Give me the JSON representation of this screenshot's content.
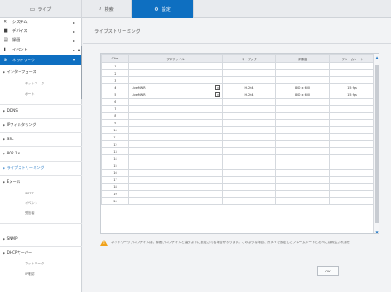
{
  "tabs": [
    {
      "label": "ライブ",
      "icon": "monitor-icon"
    },
    {
      "label": "検索",
      "icon": "search-icon"
    },
    {
      "label": "設定",
      "icon": "gear-icon"
    }
  ],
  "sidebar": {
    "top_items": [
      {
        "label": "システム",
        "icon": "tools-icon"
      },
      {
        "label": "デバイス",
        "icon": "camera-icon"
      },
      {
        "label": "録画",
        "icon": "record-icon"
      },
      {
        "label": "イベント",
        "icon": "event-icon"
      },
      {
        "label": "ネットワーク",
        "icon": "network-icon"
      }
    ],
    "sections": [
      {
        "label": "インターフェース",
        "subs": [
          "ネットワーク",
          "ポート"
        ]
      },
      {
        "label": "DDNS",
        "subs": []
      },
      {
        "label": "IPフィルタリング",
        "subs": []
      },
      {
        "label": "SSL",
        "subs": []
      },
      {
        "label": "802.1x",
        "subs": []
      },
      {
        "label": "ライブストリーミング",
        "subs": []
      },
      {
        "label": "Eメール",
        "subs": [
          "SMTP",
          "イベント",
          "受信者"
        ]
      },
      {
        "label": "SNMP",
        "subs": []
      },
      {
        "label": "DHCPサーバー",
        "subs": [
          "ネットワーク",
          "IP確認"
        ]
      }
    ]
  },
  "page": {
    "title": "ライブストリーミング"
  },
  "table": {
    "headers": [
      "CH↔",
      "プロファイル",
      "コーデック",
      "解像度",
      "フレームレート"
    ],
    "rows": [
      {
        "ch": "1",
        "profile": "",
        "codec": "",
        "res": "",
        "fps": ""
      },
      {
        "ch": "2",
        "profile": "",
        "codec": "",
        "res": "",
        "fps": ""
      },
      {
        "ch": "3",
        "profile": "",
        "codec": "",
        "res": "",
        "fps": ""
      },
      {
        "ch": "4",
        "profile": "LiveMWR",
        "codec": "H.264",
        "res": "800 x 600",
        "fps": "15 fps"
      },
      {
        "ch": "5",
        "profile": "LiveMWR",
        "codec": "H.264",
        "res": "800 x 600",
        "fps": "15 fps"
      },
      {
        "ch": "6",
        "profile": "",
        "codec": "",
        "res": "",
        "fps": ""
      },
      {
        "ch": "7",
        "profile": "",
        "codec": "",
        "res": "",
        "fps": ""
      },
      {
        "ch": "8",
        "profile": "",
        "codec": "",
        "res": "",
        "fps": ""
      },
      {
        "ch": "9",
        "profile": "",
        "codec": "",
        "res": "",
        "fps": ""
      },
      {
        "ch": "10",
        "profile": "",
        "codec": "",
        "res": "",
        "fps": ""
      },
      {
        "ch": "11",
        "profile": "",
        "codec": "",
        "res": "",
        "fps": ""
      },
      {
        "ch": "12",
        "profile": "",
        "codec": "",
        "res": "",
        "fps": ""
      },
      {
        "ch": "13",
        "profile": "",
        "codec": "",
        "res": "",
        "fps": ""
      },
      {
        "ch": "14",
        "profile": "",
        "codec": "",
        "res": "",
        "fps": ""
      },
      {
        "ch": "15",
        "profile": "",
        "codec": "",
        "res": "",
        "fps": ""
      },
      {
        "ch": "16",
        "profile": "",
        "codec": "",
        "res": "",
        "fps": ""
      },
      {
        "ch": "17",
        "profile": "",
        "codec": "",
        "res": "",
        "fps": ""
      },
      {
        "ch": "18",
        "profile": "",
        "codec": "",
        "res": "",
        "fps": ""
      },
      {
        "ch": "19",
        "profile": "",
        "codec": "",
        "res": "",
        "fps": ""
      },
      {
        "ch": "20",
        "profile": "",
        "codec": "",
        "res": "",
        "fps": ""
      }
    ]
  },
  "warning": {
    "text": "ネットワークプロファイルは、録画プロファイルと違うように設定される場合があります。このような場合、カメラで設定したフレームレートとおりには再生されませ"
  },
  "ok_label": "OK",
  "colors": {
    "accent": "#0e6fc1",
    "warning": "#f0a21a"
  }
}
